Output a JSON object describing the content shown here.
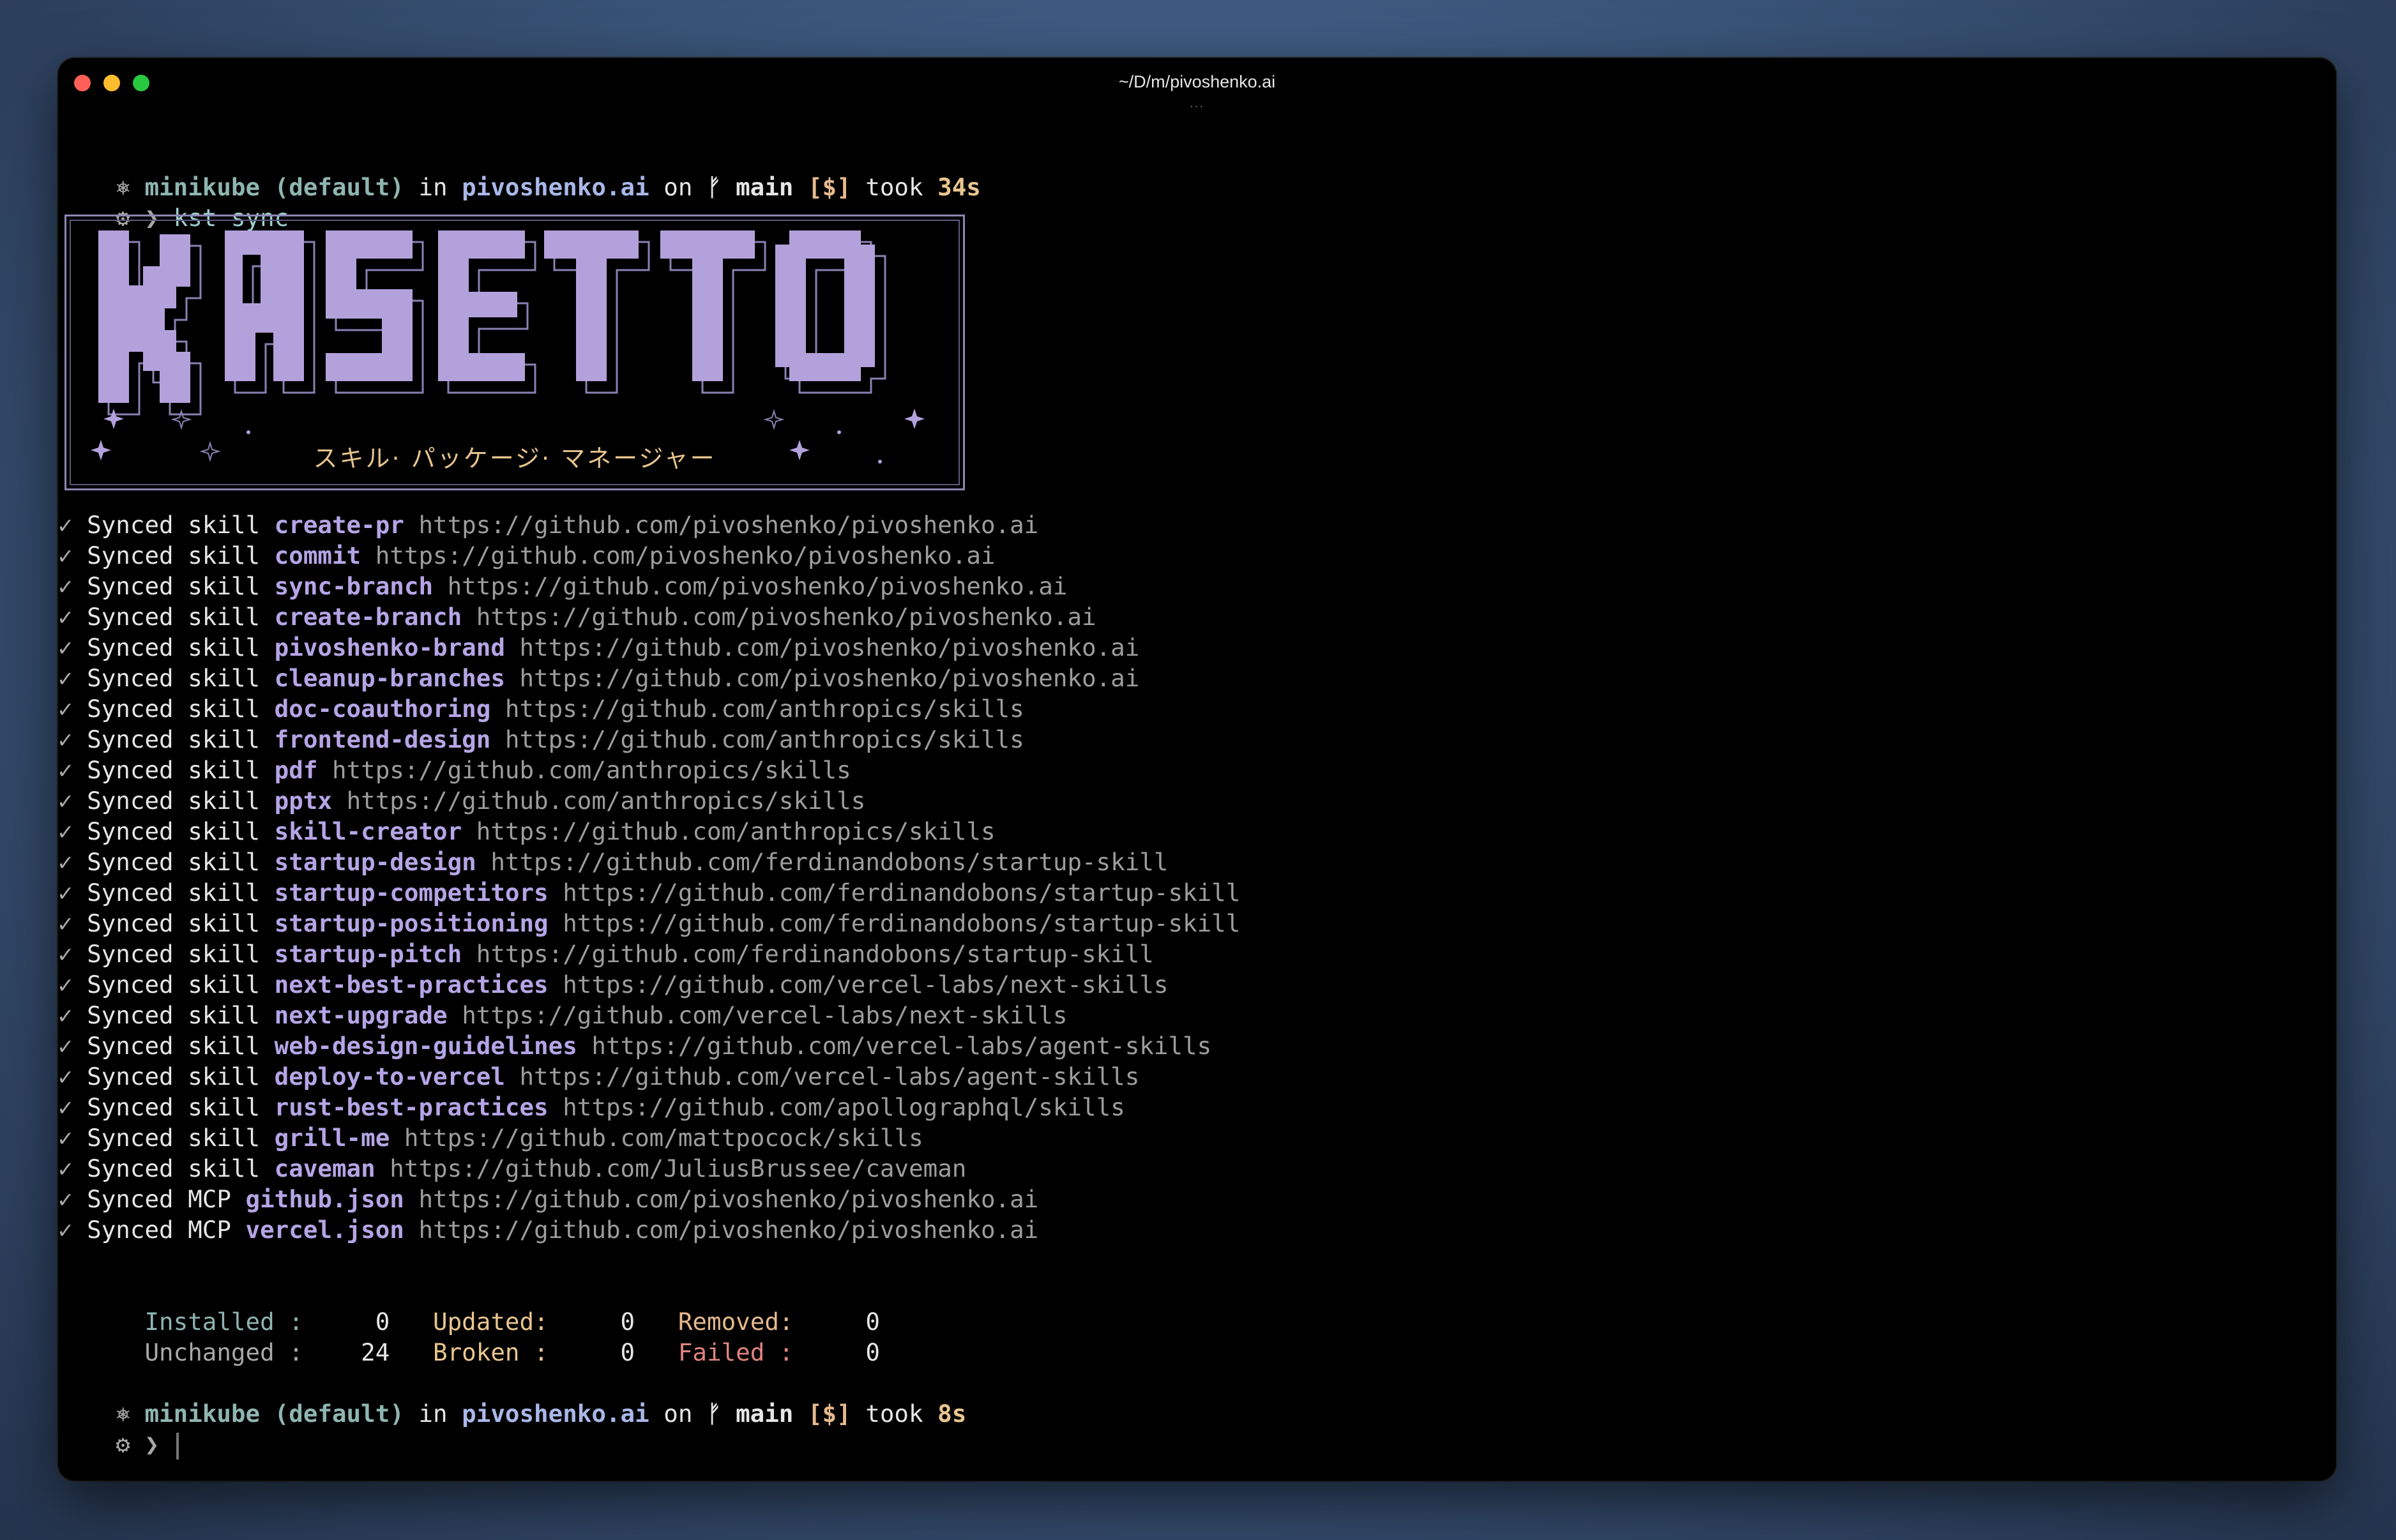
{
  "window": {
    "title": "~/D/m/pivoshenko.ai",
    "tab_indicator": "..."
  },
  "prompt": {
    "context": "minikube (default)",
    "in": "in",
    "repo": "pivoshenko.ai",
    "on": "on",
    "branch_icon": "ᚠ",
    "branch": "main",
    "status": "[$]",
    "took": "took",
    "duration_first": "34s",
    "duration_second": "8s",
    "symbol": "⚙ ❯",
    "icon": "kubernetes-icon"
  },
  "command": "kst sync",
  "banner": {
    "logo_text": "KASETTO",
    "subtitle": "スキル· パッケージ· マネージャー"
  },
  "check_symbol": "✓",
  "synced": [
    {
      "prefix": "Synced skill",
      "name": "create-pr",
      "url": "https://github.com/pivoshenko/pivoshenko.ai"
    },
    {
      "prefix": "Synced skill",
      "name": "commit",
      "url": "https://github.com/pivoshenko/pivoshenko.ai"
    },
    {
      "prefix": "Synced skill",
      "name": "sync-branch",
      "url": "https://github.com/pivoshenko/pivoshenko.ai"
    },
    {
      "prefix": "Synced skill",
      "name": "create-branch",
      "url": "https://github.com/pivoshenko/pivoshenko.ai"
    },
    {
      "prefix": "Synced skill",
      "name": "pivoshenko-brand",
      "url": "https://github.com/pivoshenko/pivoshenko.ai"
    },
    {
      "prefix": "Synced skill",
      "name": "cleanup-branches",
      "url": "https://github.com/pivoshenko/pivoshenko.ai"
    },
    {
      "prefix": "Synced skill",
      "name": "doc-coauthoring",
      "url": "https://github.com/anthropics/skills"
    },
    {
      "prefix": "Synced skill",
      "name": "frontend-design",
      "url": "https://github.com/anthropics/skills"
    },
    {
      "prefix": "Synced skill",
      "name": "pdf",
      "url": "https://github.com/anthropics/skills"
    },
    {
      "prefix": "Synced skill",
      "name": "pptx",
      "url": "https://github.com/anthropics/skills"
    },
    {
      "prefix": "Synced skill",
      "name": "skill-creator",
      "url": "https://github.com/anthropics/skills"
    },
    {
      "prefix": "Synced skill",
      "name": "startup-design",
      "url": "https://github.com/ferdinandobons/startup-skill"
    },
    {
      "prefix": "Synced skill",
      "name": "startup-competitors",
      "url": "https://github.com/ferdinandobons/startup-skill"
    },
    {
      "prefix": "Synced skill",
      "name": "startup-positioning",
      "url": "https://github.com/ferdinandobons/startup-skill"
    },
    {
      "prefix": "Synced skill",
      "name": "startup-pitch",
      "url": "https://github.com/ferdinandobons/startup-skill"
    },
    {
      "prefix": "Synced skill",
      "name": "next-best-practices",
      "url": "https://github.com/vercel-labs/next-skills"
    },
    {
      "prefix": "Synced skill",
      "name": "next-upgrade",
      "url": "https://github.com/vercel-labs/next-skills"
    },
    {
      "prefix": "Synced skill",
      "name": "web-design-guidelines",
      "url": "https://github.com/vercel-labs/agent-skills"
    },
    {
      "prefix": "Synced skill",
      "name": "deploy-to-vercel",
      "url": "https://github.com/vercel-labs/agent-skills"
    },
    {
      "prefix": "Synced skill",
      "name": "rust-best-practices",
      "url": "https://github.com/apollographql/skills"
    },
    {
      "prefix": "Synced skill",
      "name": "grill-me",
      "url": "https://github.com/mattpocock/skills"
    },
    {
      "prefix": "Synced skill",
      "name": "caveman",
      "url": "https://github.com/JuliusBrussee/caveman"
    },
    {
      "prefix": "Synced MCP",
      "name": "github.json",
      "url": "https://github.com/pivoshenko/pivoshenko.ai"
    },
    {
      "prefix": "Synced MCP",
      "name": "vercel.json",
      "url": "https://github.com/pivoshenko/pivoshenko.ai"
    }
  ],
  "summary": {
    "installed_label": "Installed :",
    "installed": "0",
    "updated_label": "Updated:",
    "updated": "0",
    "removed_label": "Removed:",
    "removed": "0",
    "unchanged_label": "Unchanged :",
    "unchanged": "24",
    "broken_label": "Broken :",
    "broken": "0",
    "failed_label": "Failed :",
    "failed": "0"
  },
  "colors": {
    "skill_name": "#b5a5e6",
    "url": "#9d9d9d",
    "duration": "#e9c68f",
    "banner_fill": "#b3a1dc"
  }
}
